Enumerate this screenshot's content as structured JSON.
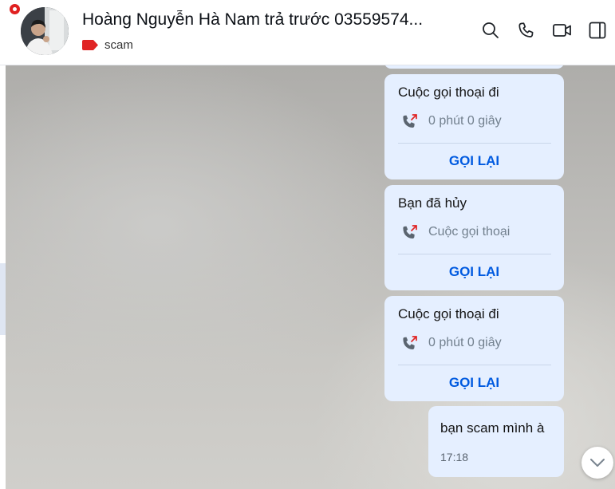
{
  "header": {
    "contact_name": "Hoàng Nguyễn Hà Nam trả trước 03559574...",
    "tag_label": "scam",
    "tag_color": "#e02424",
    "icons": [
      "search-icon",
      "phone-icon",
      "video-call-icon",
      "panel-toggle-icon"
    ]
  },
  "messages": [
    {
      "type": "call",
      "title": "Cuộc gọi thoại đi",
      "desc": "0 phút 0 giây",
      "button": "GỌI LẠI"
    },
    {
      "type": "call",
      "title": "Bạn đã hủy",
      "desc": "Cuộc gọi thoại",
      "button": "GỌI LẠI"
    },
    {
      "type": "call",
      "title": "Cuộc gọi thoại đi",
      "desc": "0 phút 0 giây",
      "button": "GỌI LẠI"
    },
    {
      "type": "text",
      "text": "bạn scam mình à",
      "time": "17:18"
    }
  ],
  "colors": {
    "bubble": "#e5efff",
    "accent": "#005ae0",
    "missed_arrow": "#e02424"
  }
}
